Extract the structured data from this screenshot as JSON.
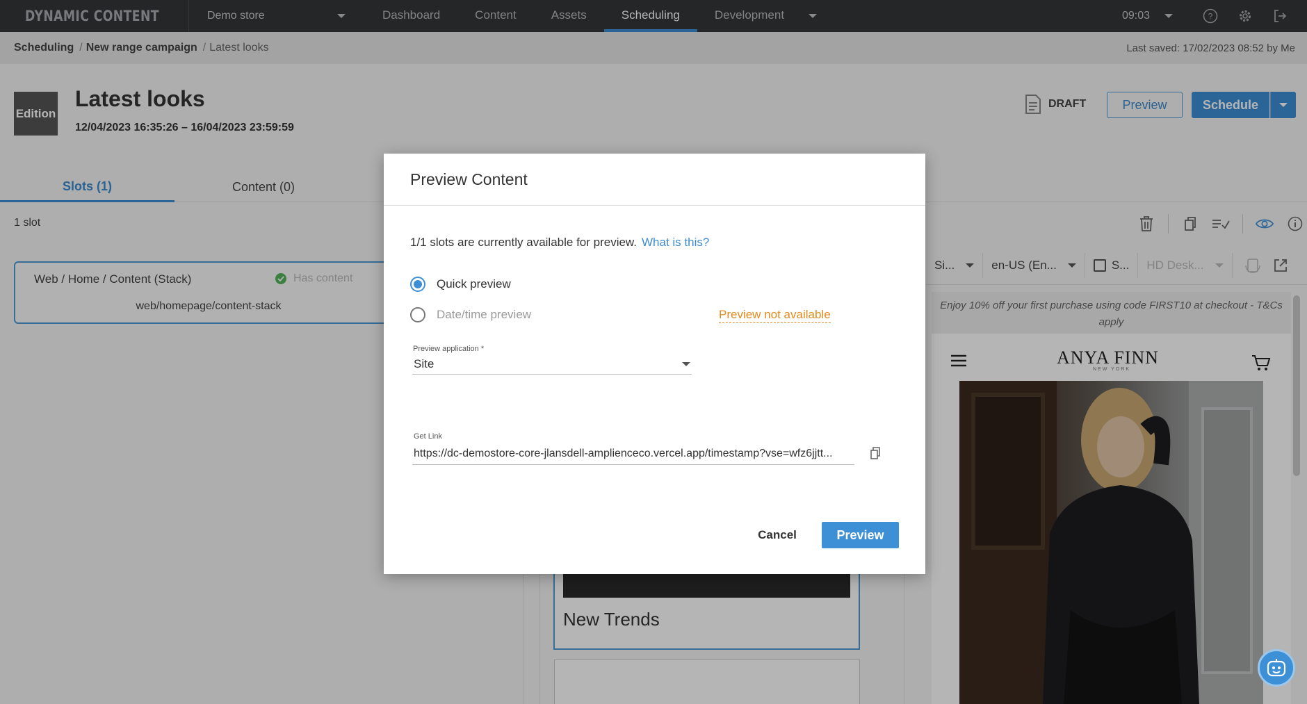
{
  "topnav": {
    "brand": "DYNAMIC CONTENT",
    "store": "Demo store",
    "tabs": [
      "Dashboard",
      "Content",
      "Assets",
      "Scheduling",
      "Development"
    ],
    "active_tab": "Scheduling",
    "clock": "09:03",
    "icons": [
      "help-icon",
      "gear-icon",
      "logout-icon"
    ]
  },
  "breadcrumb": {
    "items": [
      "Scheduling",
      "New range campaign",
      "Latest looks"
    ],
    "last_saved": "Last saved: 17/02/2023 08:52 by Me"
  },
  "header": {
    "badge": "Edition",
    "title": "Latest looks",
    "dates": "12/04/2023 16:35:26  –  16/04/2023 23:59:59",
    "status": "DRAFT",
    "preview_label": "Preview",
    "schedule_label": "Schedule"
  },
  "tabs": [
    "Slots (1)",
    "Content (0)"
  ],
  "slots": {
    "count": "1 slot",
    "card": {
      "path": "Web / Home / Content (Stack)",
      "status": "Has content",
      "key": "web/homepage/content-stack"
    }
  },
  "canvas": {
    "card_title": "New Trends"
  },
  "preview_pane": {
    "app_select": "Si...",
    "locale_select": "en-US (En...",
    "checkbox_label": "S...",
    "device_select": "HD Desk...",
    "promo": "Enjoy 10% off your first purchase using code FIRST10 at checkout - T&Cs apply",
    "logo": "ANYA FINN",
    "logo_sub": "NEW YORK"
  },
  "modal": {
    "title": "Preview Content",
    "availability": "1/1 slots are currently available for preview.",
    "what_link": "What is this?",
    "options": [
      "Quick preview",
      "Date/time preview"
    ],
    "selected_option": "Quick preview",
    "not_available": "Preview not available",
    "app_label": "Preview application *",
    "app_value": "Site",
    "link_label": "Get Link",
    "link_value": "https://dc-demostore-core-jlansdell-amplienceco.vercel.app/timestamp?vse=wfz6jjtt...",
    "cancel_label": "Cancel",
    "preview_label": "Preview"
  },
  "colors": {
    "accent": "#3d8fd6",
    "nav_bg": "#333639",
    "warning": "#e08a1e",
    "success": "#57b35b"
  }
}
